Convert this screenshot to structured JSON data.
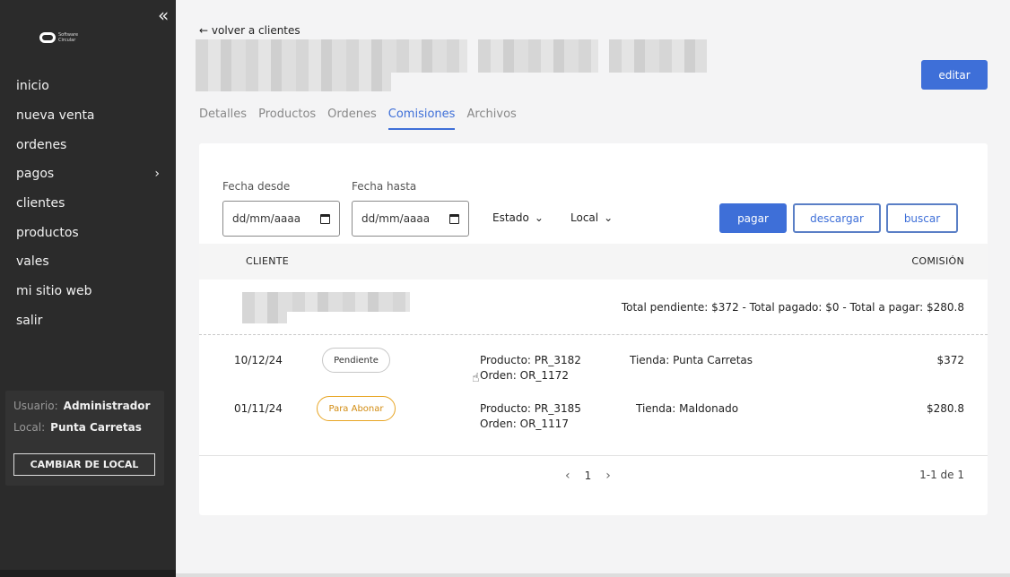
{
  "sidebar": {
    "collapse_icon": "double-chevron-left-icon",
    "logo_text": "Software Circular",
    "items": [
      {
        "label": "inicio"
      },
      {
        "label": "nueva venta"
      },
      {
        "label": "ordenes"
      },
      {
        "label": "pagos",
        "has_submenu": true
      },
      {
        "label": "clientes"
      },
      {
        "label": "productos"
      },
      {
        "label": "vales"
      },
      {
        "label": "mi sitio web"
      },
      {
        "label": "salir"
      }
    ],
    "user_label": "Usuario:",
    "user_value": "Administrador",
    "local_label": "Local:",
    "local_value": "Punta Carretas",
    "change_local_button": "CAMBIAR DE LOCAL"
  },
  "header": {
    "back_link": "← volver a clientes",
    "edit_button": "editar"
  },
  "tabs": [
    {
      "label": "Detalles",
      "active": false
    },
    {
      "label": "Productos",
      "active": false
    },
    {
      "label": "Ordenes",
      "active": false
    },
    {
      "label": "Comisiones",
      "active": true
    },
    {
      "label": "Archivos",
      "active": false
    }
  ],
  "filters": {
    "date_from_label": "Fecha desde",
    "date_from_placeholder": "dd/mm/aaaa",
    "date_to_label": "Fecha hasta",
    "date_to_placeholder": "dd/mm/aaaa",
    "estado_label": "Estado",
    "local_label": "Local",
    "pay_button": "pagar",
    "download_button": "descargar",
    "search_button": "buscar"
  },
  "table": {
    "columns": [
      "CLIENTE",
      "COMISIÓN"
    ],
    "group_totals": "Total pendiente: $372 - Total pagado: $0 - Total a pagar: $280.8",
    "rows": [
      {
        "date": "10/12/24",
        "status": "Pendiente",
        "product": "Producto: PR_3182",
        "order": "Orden: OR_1172",
        "store": "Tienda: Punta Carretas",
        "amount": "$372"
      },
      {
        "date": "01/11/24",
        "status": "Para Abonar",
        "product": "Producto: PR_3185",
        "order": "Orden: OR_1117",
        "store": "Tienda: Maldonado",
        "amount": "$280.8"
      }
    ],
    "page": "1",
    "range": "1-1 de 1"
  },
  "colors": {
    "accent": "#3e6fd8",
    "sidebar_bg": "#2b2b2b",
    "badge_abonar": "#e8a524"
  }
}
